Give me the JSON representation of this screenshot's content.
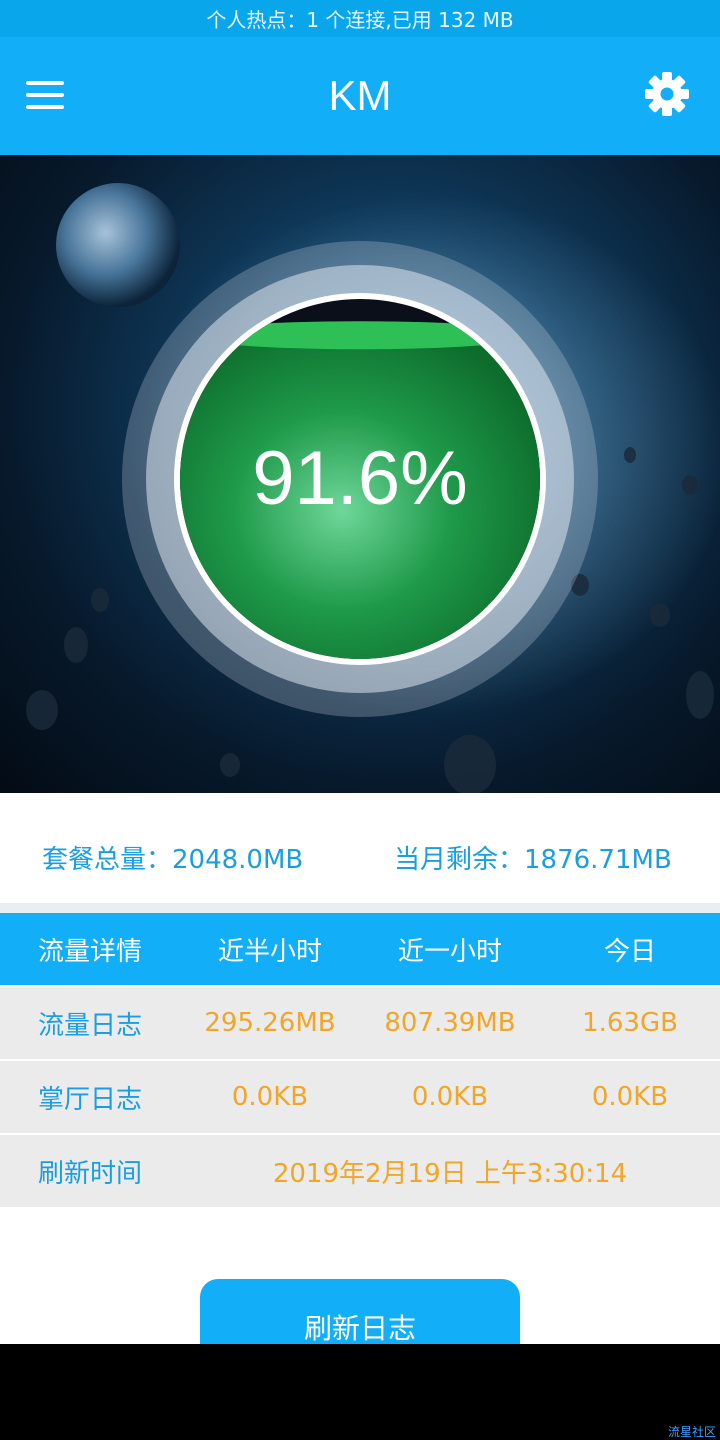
{
  "status_bar": {
    "text": "个人热点：1 个连接,已用 132 MB"
  },
  "app_bar": {
    "title": "KM",
    "menu_icon": "menu-icon",
    "settings_icon": "gear-icon",
    "color": "#12aef7"
  },
  "gauge": {
    "percent_text": "91.6%",
    "level": 0.916
  },
  "summary": {
    "total_label": "套餐总量：2048.0MB",
    "remaining_label": "当月剩余：1876.71MB"
  },
  "table": {
    "headers": [
      "流量详情",
      "近半小时",
      "近一小时",
      "今日"
    ],
    "rows": [
      {
        "label": "流量日志",
        "values": [
          "295.26MB",
          "807.39MB",
          "1.63GB"
        ]
      },
      {
        "label": "掌厅日志",
        "values": [
          "0.0KB",
          "0.0KB",
          "0.0KB"
        ]
      }
    ],
    "refresh_time": {
      "label": "刷新时间",
      "value": "2019年2月19日  上午3:30:14"
    }
  },
  "refresh_button": {
    "label": "刷新日志"
  },
  "watermark": "流星社区",
  "colors": {
    "accent": "#12aef7",
    "value": "#f0a628",
    "label": "#1a9ee0"
  }
}
